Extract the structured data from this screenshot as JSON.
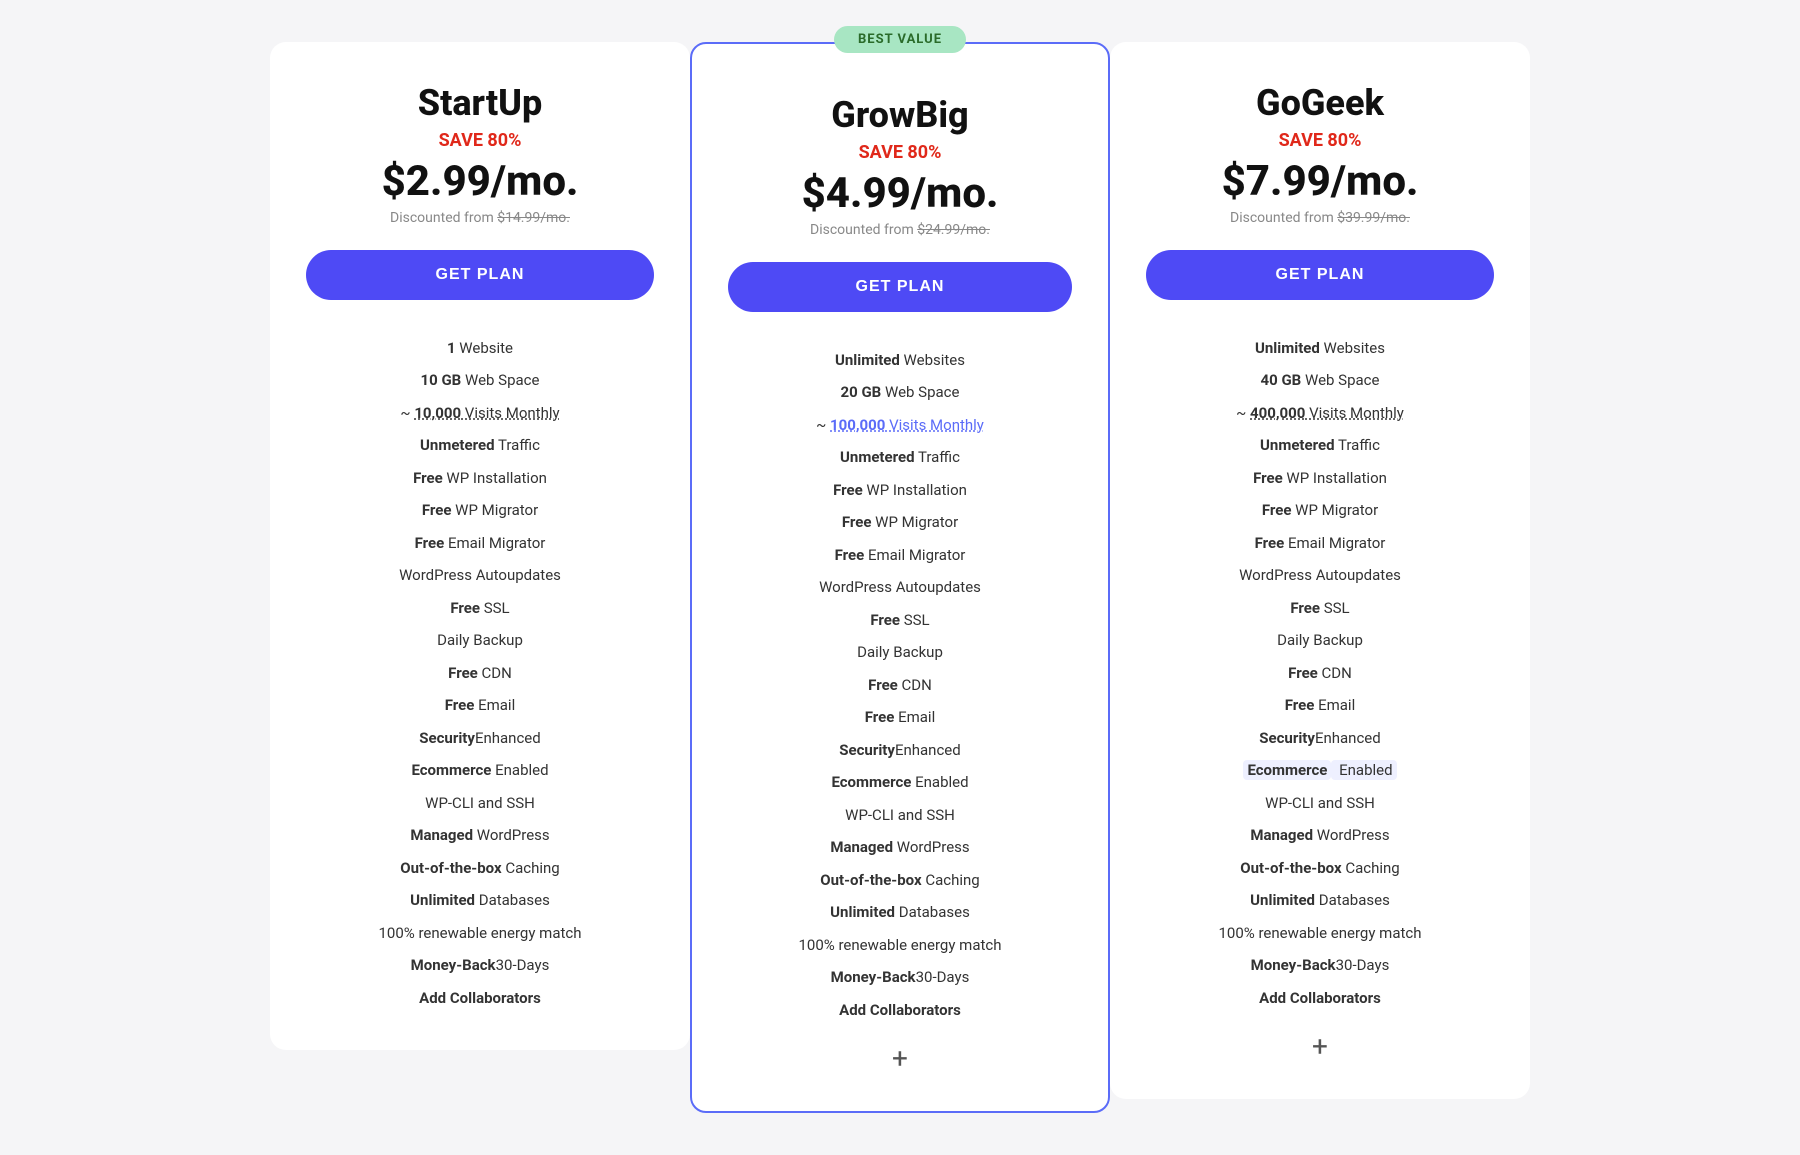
{
  "plans": [
    {
      "id": "startup",
      "name": "StartUp",
      "save": "SAVE 80%",
      "price": "$2.99/mo.",
      "discounted_from": "Discounted from $14.99/mo.",
      "discounted_original": "$14.99/mo.",
      "button_label": "GET PLAN",
      "featured": false,
      "features": [
        {
          "bold": "1",
          "normal": " Website"
        },
        {
          "bold": "10 GB",
          "normal": " Web Space"
        },
        {
          "normal": "~ ",
          "bold": "10,000",
          "suffix": " Visits Monthly",
          "highlight": false,
          "underline": true
        },
        {
          "bold": "Unmetered",
          "normal": " Traffic"
        },
        {
          "bold": "Free",
          "normal": " WP Installation"
        },
        {
          "bold": "Free",
          "normal": " WP Migrator"
        },
        {
          "bold": "Free",
          "normal": " Email Migrator"
        },
        {
          "normal": "WordPress Autoupdates"
        },
        {
          "bold": "Free",
          "normal": " SSL"
        },
        {
          "normal": "Daily Backup"
        },
        {
          "bold": "Free",
          "normal": " CDN"
        },
        {
          "bold": "Free",
          "normal": " Email"
        },
        {
          "normal": "Enhanced ",
          "bold": "Security"
        },
        {
          "bold": "Ecommerce",
          "normal": " Enabled"
        },
        {
          "normal": "WP-CLI and SSH"
        },
        {
          "bold": "Managed",
          "normal": " WordPress"
        },
        {
          "bold": "Out-of-the-box",
          "normal": " Caching"
        },
        {
          "bold": "Unlimited",
          "normal": " Databases"
        },
        {
          "normal": "100% renewable energy match"
        },
        {
          "normal": "30-Days ",
          "bold": "Money-Back"
        },
        {
          "bold": "Add Collaborators"
        }
      ]
    },
    {
      "id": "growbig",
      "name": "GrowBig",
      "save": "SAVE 80%",
      "price": "$4.99/mo.",
      "discounted_from": "Discounted from $24.99/mo.",
      "discounted_original": "$24.99/mo.",
      "button_label": "GET PLAN",
      "featured": true,
      "best_value": "BEST VALUE",
      "features": [
        {
          "bold": "Unlimited",
          "normal": " Websites"
        },
        {
          "bold": "20 GB",
          "normal": " Web Space"
        },
        {
          "normal": "~ ",
          "bold": "100,000",
          "suffix": " Visits Monthly",
          "highlight": true,
          "underline": true
        },
        {
          "bold": "Unmetered",
          "normal": " Traffic"
        },
        {
          "bold": "Free",
          "normal": " WP Installation"
        },
        {
          "bold": "Free",
          "normal": " WP Migrator"
        },
        {
          "bold": "Free",
          "normal": " Email Migrator"
        },
        {
          "normal": "WordPress Autoupdates"
        },
        {
          "bold": "Free",
          "normal": " SSL"
        },
        {
          "normal": "Daily Backup"
        },
        {
          "bold": "Free",
          "normal": " CDN"
        },
        {
          "bold": "Free",
          "normal": " Email"
        },
        {
          "normal": "Enhanced ",
          "bold": "Security"
        },
        {
          "bold": "Ecommerce",
          "normal": " Enabled"
        },
        {
          "normal": "WP-CLI and SSH"
        },
        {
          "bold": "Managed",
          "normal": " WordPress"
        },
        {
          "bold": "Out-of-the-box",
          "normal": " Caching"
        },
        {
          "bold": "Unlimited",
          "normal": " Databases"
        },
        {
          "normal": "100% renewable energy match"
        },
        {
          "normal": "30-Days ",
          "bold": "Money-Back"
        },
        {
          "bold": "Add Collaborators"
        }
      ],
      "has_plus": true
    },
    {
      "id": "gogeek",
      "name": "GoGeek",
      "save": "SAVE 80%",
      "price": "$7.99/mo.",
      "discounted_from": "Discounted from $39.99/mo.",
      "discounted_original": "$39.99/mo.",
      "button_label": "GET PLAN",
      "featured": false,
      "features": [
        {
          "bold": "Unlimited",
          "normal": " Websites"
        },
        {
          "bold": "40 GB",
          "normal": " Web Space"
        },
        {
          "normal": "~ ",
          "bold": "400,000",
          "suffix": " Visits Monthly",
          "highlight": false,
          "underline": true
        },
        {
          "bold": "Unmetered",
          "normal": " Traffic"
        },
        {
          "bold": "Free",
          "normal": " WP Installation"
        },
        {
          "bold": "Free",
          "normal": " WP Migrator"
        },
        {
          "bold": "Free",
          "normal": " Email Migrator"
        },
        {
          "normal": "WordPress Autoupdates"
        },
        {
          "bold": "Free",
          "normal": " SSL"
        },
        {
          "normal": "Daily Backup"
        },
        {
          "bold": "Free",
          "normal": " CDN"
        },
        {
          "bold": "Free",
          "normal": " Email"
        },
        {
          "normal": "Enhanced ",
          "bold": "Security"
        },
        {
          "bold": "Ecommerce",
          "normal": " Enabled",
          "ecommerce_highlight": true
        },
        {
          "normal": "WP-CLI and SSH"
        },
        {
          "bold": "Managed",
          "normal": " WordPress"
        },
        {
          "bold": "Out-of-the-box",
          "normal": " Caching"
        },
        {
          "bold": "Unlimited",
          "normal": " Databases"
        },
        {
          "normal": "100% renewable energy match"
        },
        {
          "normal": "30-Days ",
          "bold": "Money-Back"
        },
        {
          "bold": "Add Collaborators"
        }
      ],
      "has_plus": true
    }
  ]
}
